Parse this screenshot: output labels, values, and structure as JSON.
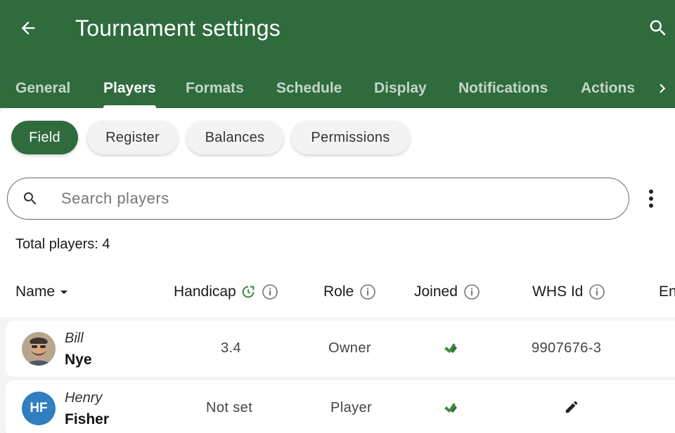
{
  "header": {
    "title": "Tournament settings"
  },
  "tabs": [
    {
      "label": "General",
      "active": false
    },
    {
      "label": "Players",
      "active": true
    },
    {
      "label": "Formats",
      "active": false
    },
    {
      "label": "Schedule",
      "active": false
    },
    {
      "label": "Display",
      "active": false
    },
    {
      "label": "Notifications",
      "active": false
    },
    {
      "label": "Actions",
      "active": false
    }
  ],
  "chips": [
    {
      "label": "Field",
      "active": true
    },
    {
      "label": "Register",
      "active": false
    },
    {
      "label": "Balances",
      "active": false
    },
    {
      "label": "Permissions",
      "active": false
    }
  ],
  "search": {
    "placeholder": "Search players",
    "value": ""
  },
  "total": {
    "label": "Total players: 4"
  },
  "columns": {
    "name": "Name",
    "handicap": "Handicap",
    "role": "Role",
    "joined": "Joined",
    "whs": "WHS Id",
    "cut": "En"
  },
  "players": [
    {
      "first": "Bill",
      "last": "Nye",
      "handicap": "3.4",
      "role": "Owner",
      "joined": "check-icon",
      "whs_id": "9907676-3",
      "avatar": "photo"
    },
    {
      "first": "Henry",
      "last": "Fisher",
      "initials": "HF",
      "handicap": "Not set",
      "role": "Player",
      "joined": "check-icon",
      "whs_id": "",
      "avatar": "initials"
    }
  ],
  "colors": {
    "primary": "#2f6b3d",
    "avatar_blue": "#2f7fc1",
    "joined_green": "#3a8a3a"
  }
}
